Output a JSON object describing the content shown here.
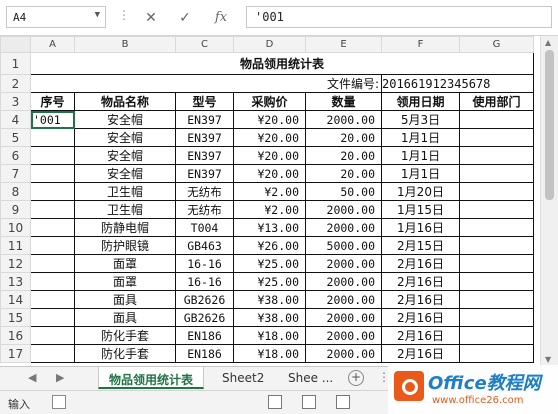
{
  "formula_bar": {
    "name_box": "A4",
    "name_box_dropdown": "▼",
    "cancel_symbol": "✕",
    "enter_symbol": "✓",
    "fx_label": "fx",
    "formula_text": "'001"
  },
  "columns": [
    "A",
    "B",
    "C",
    "D",
    "E",
    "F",
    "G"
  ],
  "rows": [
    "1",
    "2",
    "3",
    "4",
    "5",
    "6",
    "7",
    "8",
    "9",
    "10",
    "11",
    "12",
    "13",
    "14",
    "15",
    "16",
    "17"
  ],
  "sheet": {
    "title": "物品领用统计表",
    "file_no_label": "文件编号:",
    "file_no_value": "201661912345678",
    "headers": [
      "序号",
      "物品名称",
      "型号",
      "采购价",
      "数量",
      "领用日期",
      "使用部门"
    ],
    "data_rows": [
      {
        "no": "'001",
        "name": "安全帽",
        "model": "EN397",
        "price": "¥20.00",
        "qty": "2000.00",
        "date": "5月3日",
        "dept": ""
      },
      {
        "no": "",
        "name": "安全帽",
        "model": "EN397",
        "price": "¥20.00",
        "qty": "20.00",
        "date": "1月1日",
        "dept": ""
      },
      {
        "no": "",
        "name": "安全帽",
        "model": "EN397",
        "price": "¥20.00",
        "qty": "20.00",
        "date": "1月1日",
        "dept": ""
      },
      {
        "no": "",
        "name": "安全帽",
        "model": "EN397",
        "price": "¥20.00",
        "qty": "20.00",
        "date": "1月1日",
        "dept": ""
      },
      {
        "no": "",
        "name": "卫生帽",
        "model": "无纺布",
        "price": "¥2.00",
        "qty": "50.00",
        "date": "1月20日",
        "dept": ""
      },
      {
        "no": "",
        "name": "卫生帽",
        "model": "无纺布",
        "price": "¥2.00",
        "qty": "2000.00",
        "date": "1月15日",
        "dept": ""
      },
      {
        "no": "",
        "name": "防静电帽",
        "model": "T004",
        "price": "¥13.00",
        "qty": "2000.00",
        "date": "1月16日",
        "dept": ""
      },
      {
        "no": "",
        "name": "防护眼镜",
        "model": "GB463",
        "price": "¥26.00",
        "qty": "5000.00",
        "date": "2月15日",
        "dept": ""
      },
      {
        "no": "",
        "name": "面罩",
        "model": "16-16",
        "price": "¥25.00",
        "qty": "2000.00",
        "date": "2月16日",
        "dept": ""
      },
      {
        "no": "",
        "name": "面罩",
        "model": "16-16",
        "price": "¥25.00",
        "qty": "2000.00",
        "date": "2月16日",
        "dept": ""
      },
      {
        "no": "",
        "name": "面具",
        "model": "GB2626",
        "price": "¥38.00",
        "qty": "2000.00",
        "date": "2月16日",
        "dept": ""
      },
      {
        "no": "",
        "name": "面具",
        "model": "GB2626",
        "price": "¥38.00",
        "qty": "2000.00",
        "date": "2月16日",
        "dept": ""
      },
      {
        "no": "",
        "name": "防化手套",
        "model": "EN186",
        "price": "¥18.00",
        "qty": "2000.00",
        "date": "2月16日",
        "dept": ""
      },
      {
        "no": "",
        "name": "防化手套",
        "model": "EN186",
        "price": "¥18.00",
        "qty": "2000.00",
        "date": "2月16日",
        "dept": ""
      }
    ]
  },
  "tabs": {
    "prev": "◀",
    "next": "▶",
    "sheets": [
      "物品领用统计表",
      "Sheet2",
      "Shee ..."
    ],
    "add": "+",
    "more": "⋮"
  },
  "status": {
    "ready": "输入"
  },
  "watermark": {
    "brand": "Office教程网",
    "url": "www.office26.com"
  },
  "colors": {
    "accent": "#217346",
    "grid_border": "#111111",
    "header_bg": "#f3f3f3",
    "watermark_orange": "#e8591a",
    "watermark_blue": "#1e7fc6"
  }
}
